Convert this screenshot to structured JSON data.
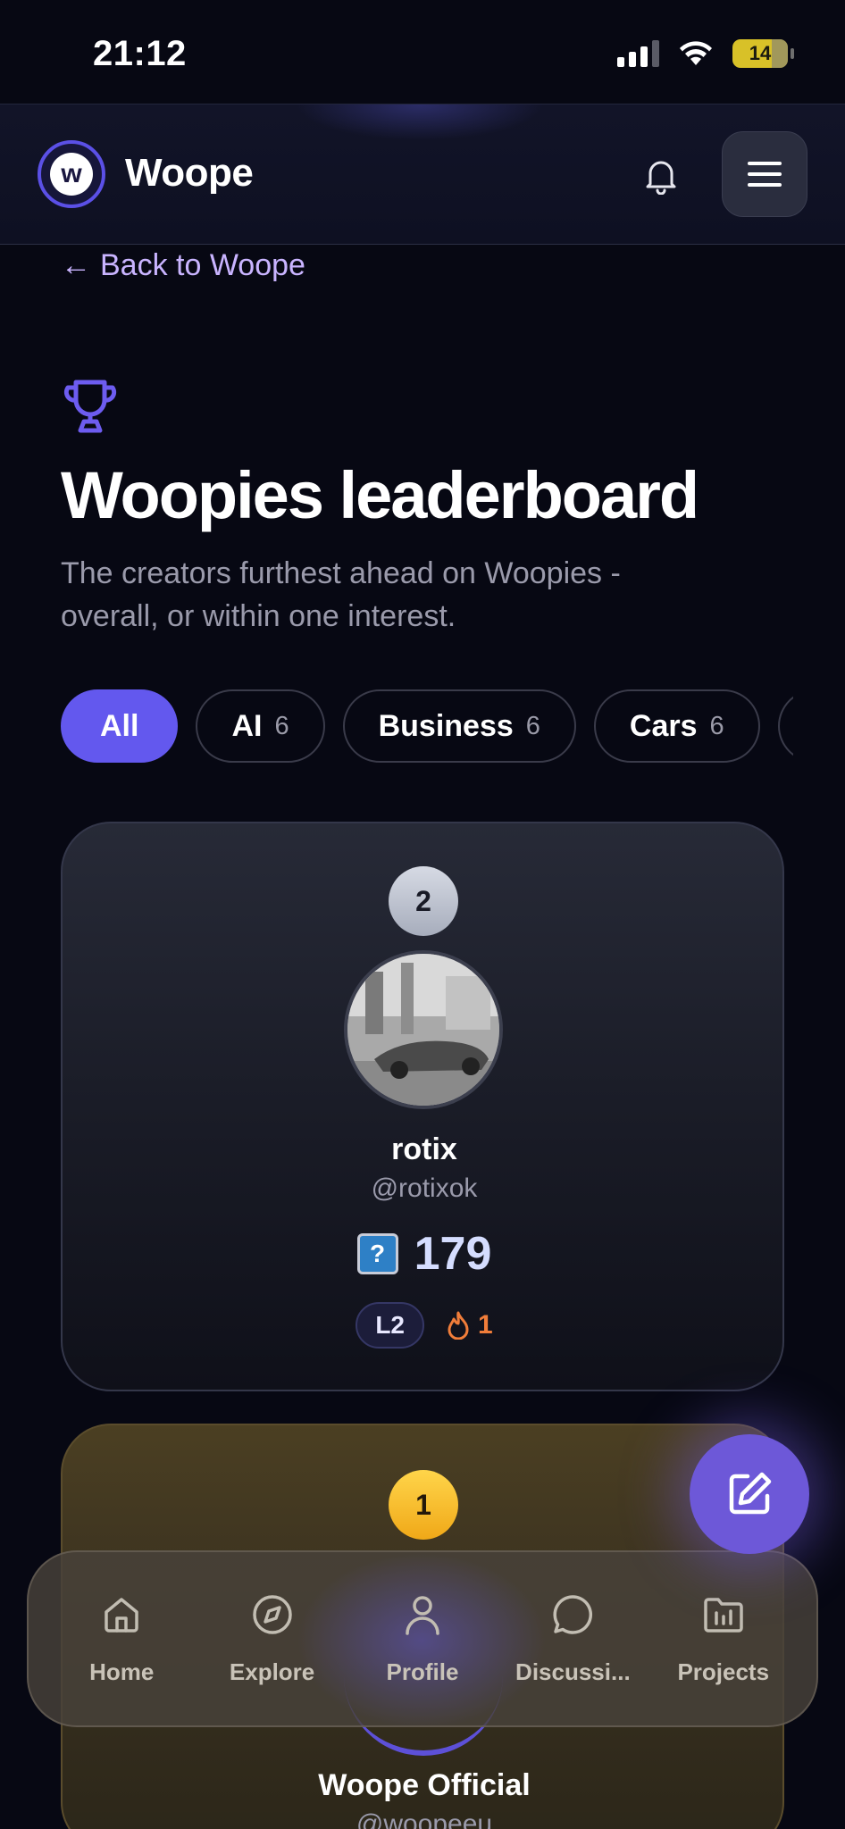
{
  "status_bar": {
    "time": "21:12",
    "battery": "14"
  },
  "header": {
    "brand": "Woope",
    "logo_letter": "w"
  },
  "back_link": {
    "arrow": "←",
    "label": "Back to Woope"
  },
  "page": {
    "title": "Woopies leaderboard",
    "subtitle": "The creators furthest ahead on Woopies - overall, or within one interest."
  },
  "filters": [
    {
      "label": "All",
      "count": "",
      "active": true
    },
    {
      "label": "AI",
      "count": "6"
    },
    {
      "label": "Business",
      "count": "6"
    },
    {
      "label": "Cars",
      "count": "6"
    }
  ],
  "leaders": [
    {
      "rank": "2",
      "name": "rotix",
      "handle": "@rotixok",
      "score_icon": "?",
      "score": "179",
      "level": "L2",
      "streak": "1"
    },
    {
      "rank": "1",
      "name": "Woope Official",
      "handle": "@woopeeu"
    }
  ],
  "bottom_nav": [
    {
      "label": "Home",
      "icon": "home-icon"
    },
    {
      "label": "Explore",
      "icon": "compass-icon"
    },
    {
      "label": "Profile",
      "icon": "user-icon"
    },
    {
      "label": "Discussi...",
      "icon": "chat-bubble-icon"
    },
    {
      "label": "Projects",
      "icon": "folder-chart-icon"
    }
  ],
  "colors": {
    "accent": "#6358ee",
    "background": "#070813",
    "gold": "#f0a818",
    "streak": "#f07d3a"
  }
}
